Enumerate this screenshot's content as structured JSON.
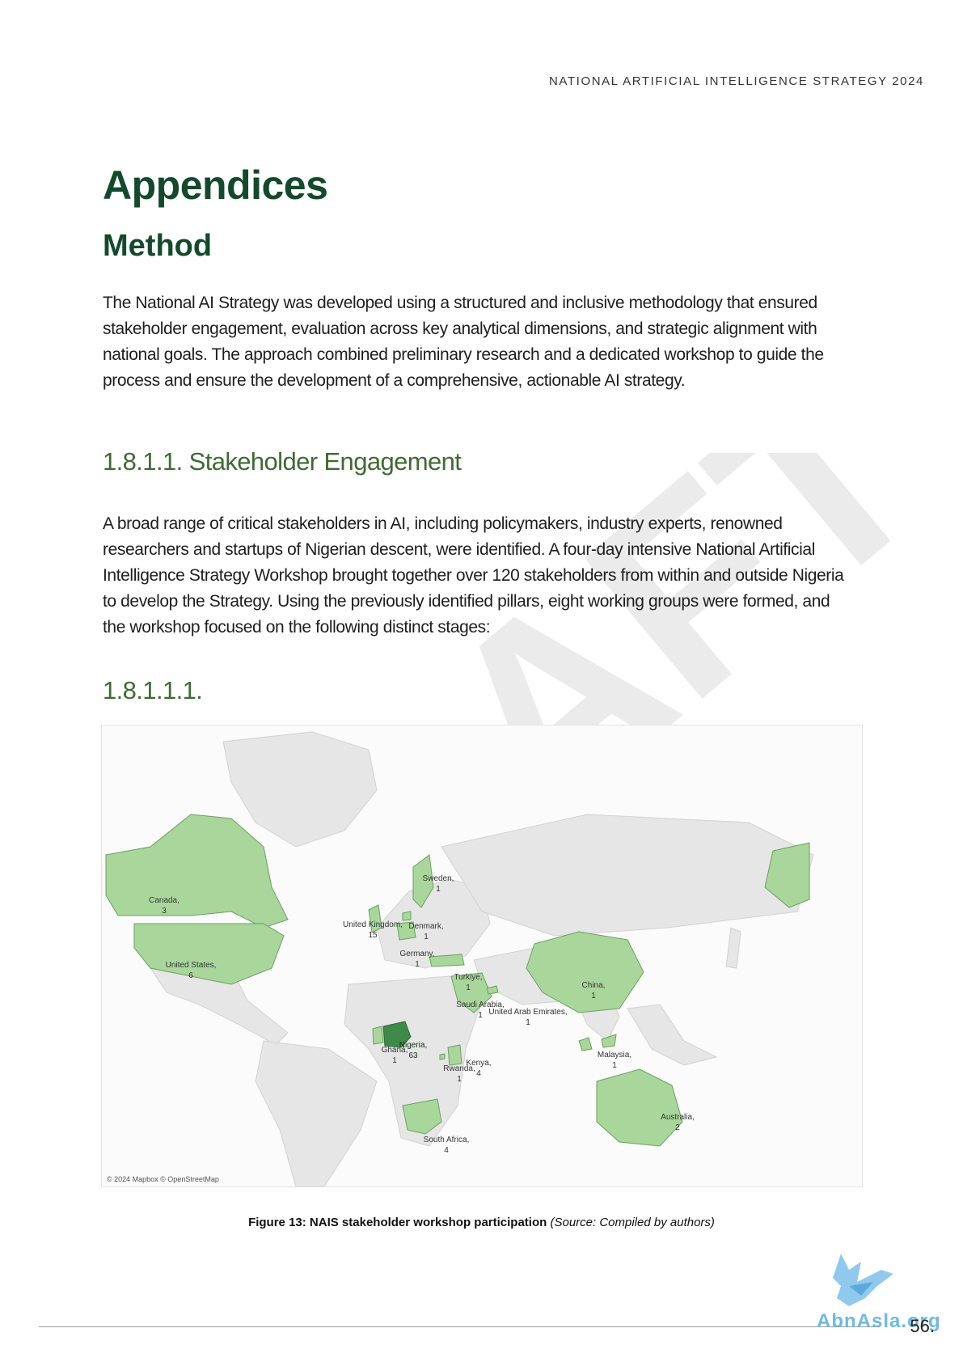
{
  "header": {
    "running_title": "NATIONAL ARTIFICIAL INTELLIGENCE STRATEGY 2024"
  },
  "watermark": {
    "text": "DRAFT"
  },
  "section": {
    "title": "Appendices",
    "subtitle": "Method",
    "intro": "The National AI Strategy was developed using a structured and inclusive methodology that ensured stakeholder engagement, evaluation across key analytical dimensions, and strategic alignment with national goals. The approach combined preliminary research and a dedicated workshop to guide the process and ensure the development of a comprehensive, actionable AI strategy.",
    "sub1_title": "1.8.1.1. Stakeholder Engagement",
    "sub1_body": "A broad range of critical stakeholders in AI, including policymakers, industry experts, renowned researchers and startups of Nigerian descent, were identified. A four-day intensive National Artificial Intelligence Strategy Workshop brought together over 120 stakeholders from within and outside Nigeria to develop the Strategy. Using the previously identified pillars, eight working groups were formed, and the workshop focused on the following distinct stages:",
    "sub2_title": "1.8.1.1.1."
  },
  "map": {
    "attribution": "© 2024 Mapbox © OpenStreetMap",
    "highlight_color": "#a9d79b",
    "highlight_dark": "#3f8a4a",
    "base_color": "#e6e6e6",
    "countries": [
      {
        "name": "Canada,",
        "count": "3"
      },
      {
        "name": "United States,",
        "count": "6"
      },
      {
        "name": "United Kingdom,",
        "count": "15"
      },
      {
        "name": "Sweden,",
        "count": "1"
      },
      {
        "name": "Denmark,",
        "count": "1"
      },
      {
        "name": "Germany,",
        "count": "1"
      },
      {
        "name": "Turkiye,",
        "count": "1"
      },
      {
        "name": "Saudi Arabia,",
        "count": "1"
      },
      {
        "name": "United Arab Emirates,",
        "count": "1"
      },
      {
        "name": "China,",
        "count": "1"
      },
      {
        "name": "Nigeria,",
        "count": "63"
      },
      {
        "name": "Ghana,",
        "count": "1"
      },
      {
        "name": "Kenya,",
        "count": "4"
      },
      {
        "name": "Rwanda,",
        "count": "1"
      },
      {
        "name": "Malaysia,",
        "count": "1"
      },
      {
        "name": "South Africa,",
        "count": "4"
      },
      {
        "name": "Australia,",
        "count": "2"
      }
    ]
  },
  "figure": {
    "label": "Figure 13: NAIS stakeholder workshop participation",
    "source": "(Source:  Compiled by authors)"
  },
  "footer": {
    "page_number": "56.",
    "logo_text": "AbnAsla.org"
  }
}
